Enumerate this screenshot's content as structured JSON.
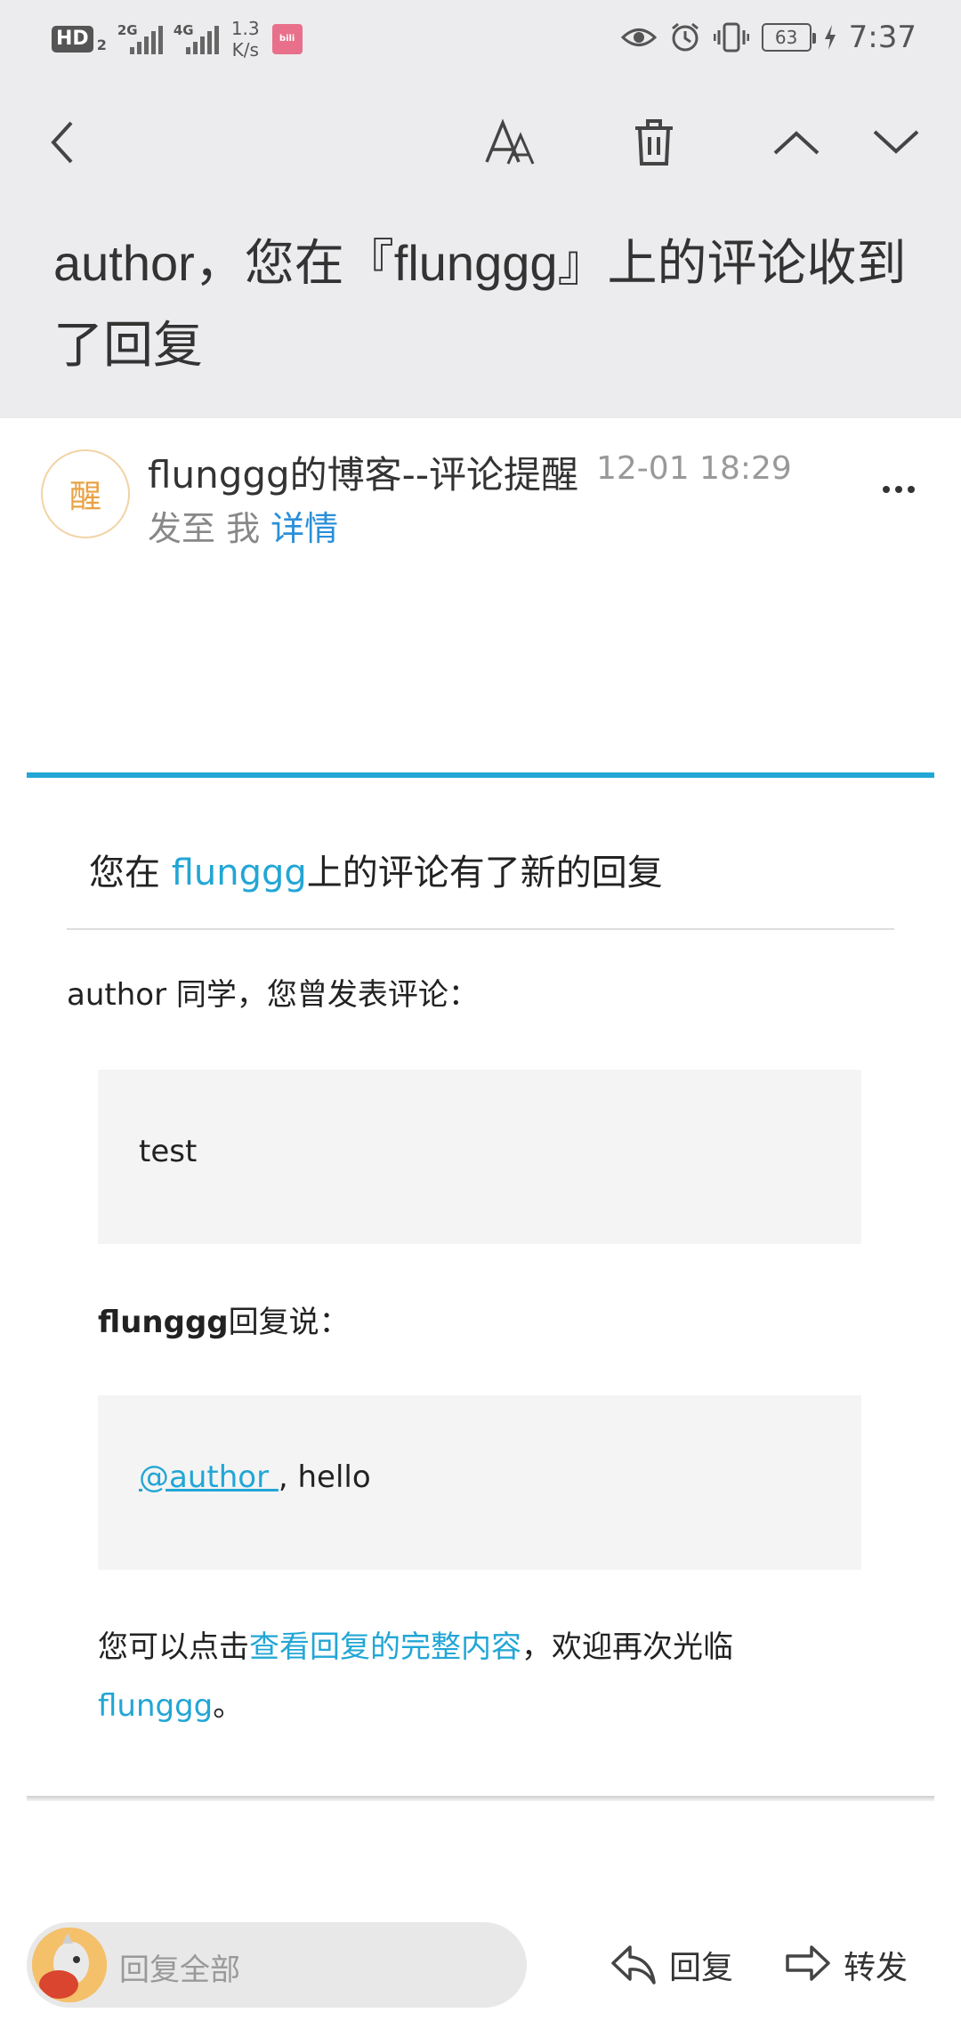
{
  "status_bar": {
    "hd": "HD",
    "hd_sub": "2",
    "sig1_label": "2G",
    "sig2_label": "4G",
    "net_speed_value": "1.3",
    "net_speed_unit": "K/s",
    "battery": "63",
    "time": "7:37"
  },
  "toolbar": {
    "icons": [
      "back-icon",
      "font-size-icon",
      "delete-icon",
      "previous-icon",
      "next-icon"
    ]
  },
  "subject": "author，您在『flunggg』上的评论收到了回复",
  "sender": {
    "avatar_text": "醒",
    "name": "flunggg的博客--评论提醒",
    "time": "12-01 18:29",
    "to": "发至 我",
    "detail_link": "详情"
  },
  "mail": {
    "heading_prefix": "您在 ",
    "heading_link": "flunggg",
    "heading_suffix": "上的评论有了新的回复",
    "greeting": "author 同学，您曾发表评论：",
    "original_comment": "test",
    "replier": "flunggg",
    "replied_suffix": "回复说：",
    "reply_mention": "@author ",
    "reply_text": ", hello",
    "footer_prefix": "您可以点击",
    "footer_link": "查看回复的完整内容",
    "footer_middle": "，欢迎再次光临",
    "footer_site": "flunggg",
    "footer_end": "。"
  },
  "bottom_bar": {
    "reply_all_placeholder": "回复全部",
    "reply_label": "回复",
    "forward_label": "转发"
  },
  "colors": {
    "accent": "#22a6d5",
    "detail_link": "#2a8fd8",
    "header_bg": "#ececee"
  }
}
